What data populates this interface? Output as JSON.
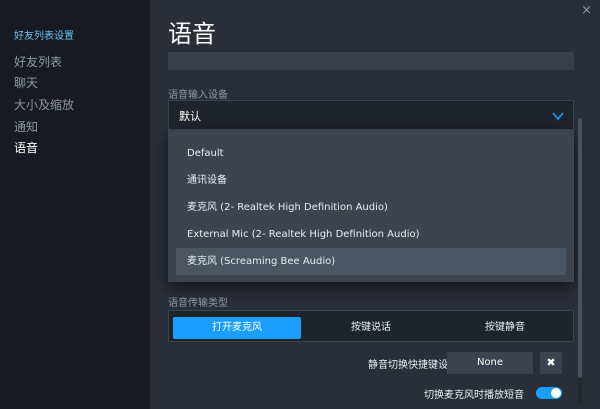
{
  "sidebar": {
    "title": "好友列表设置",
    "items": [
      {
        "label": "好友列表"
      },
      {
        "label": "聊天"
      },
      {
        "label": "大小及缩放"
      },
      {
        "label": "通知"
      },
      {
        "label": "语音"
      }
    ],
    "active_index": 4
  },
  "window": {
    "close_glyph": "×"
  },
  "main": {
    "title": "语音",
    "input_device": {
      "label": "语音输入设备",
      "selected": "默认",
      "options": [
        "Default",
        "通讯设备",
        "麦克风 (2- Realtek High Definition Audio)",
        "External Mic (2- Realtek High Definition Audio)",
        "麦克风 (Screaming Bee Audio)"
      ],
      "hovered_index": 4
    },
    "transmission": {
      "label": "语音传输类型",
      "modes": [
        "打开麦克风",
        "按键说话",
        "按键静音"
      ],
      "active_index": 0
    },
    "mute_hotkey": {
      "label": "静音切换快捷键设置为",
      "value": "None",
      "clear_glyph": "✖"
    },
    "toggle_sound": {
      "label": "切换麦克风时播放短音",
      "enabled": true
    }
  },
  "colors": {
    "accent": "#1a9fff",
    "sidebar_active_title": "#66c0f4",
    "panel_bg": "#2a2e37",
    "sidebar_bg": "#171a21"
  }
}
